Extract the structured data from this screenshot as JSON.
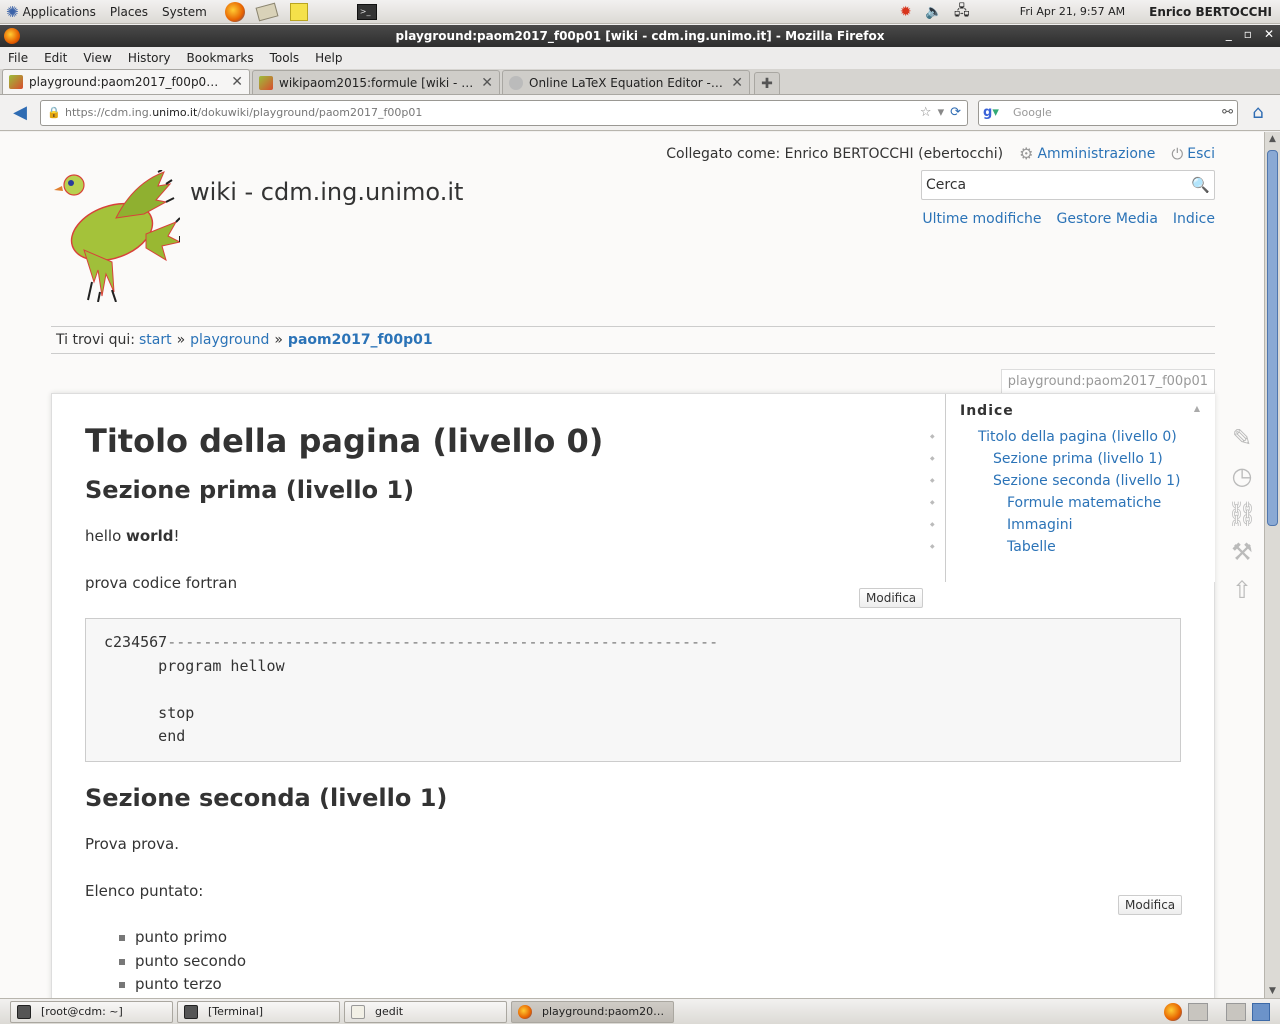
{
  "top_panel": {
    "menus": [
      "Applications",
      "Places",
      "System"
    ],
    "clock": "Fri Apr 21,  9:57 AM",
    "user": "Enrico BERTOCCHI"
  },
  "window": {
    "title": "playground:paom2017_f00p01 [wiki - cdm.ing.unimo.it] - Mozilla Firefox"
  },
  "menubar": [
    "File",
    "Edit",
    "View",
    "History",
    "Bookmarks",
    "Tools",
    "Help"
  ],
  "tabs": [
    {
      "label": "playground:paom2017_f00p01 [wik..."
    },
    {
      "label": "wikipaom2015:formule [wiki - cdm.i..."
    },
    {
      "label": "Online LaTeX Equation Editor - creat..."
    }
  ],
  "navbar": {
    "url_prefix": "https://cdm.ing.",
    "url_domain": "unimo.it",
    "url_suffix": "/dokuwiki/playground/paom2017_f00p01",
    "search_placeholder": "Google"
  },
  "wiki": {
    "user_label": "Collegato come: Enrico BERTOCCHI (ebertocchi)",
    "admin_link": "Amministrazione",
    "logout_link": "Esci",
    "site_title": "wiki - cdm.ing.unimo.it",
    "search_value": "Cerca",
    "quicklinks": [
      "Ultime modifiche",
      "Gestore Media",
      "Indice"
    ],
    "breadcrumb_label": "Ti trovi qui:",
    "breadcrumb": [
      "start",
      "playground",
      "paom2017_f00p01"
    ],
    "breadcrumb_sep": "»",
    "page_id": "playground:paom2017_f00p01",
    "edit_label": "Modifica"
  },
  "toc": {
    "title": "Indice",
    "items": [
      {
        "label": "Titolo della pagina (livello 0)",
        "level": 1
      },
      {
        "label": "Sezione prima (livello 1)",
        "level": 2
      },
      {
        "label": "Sezione seconda (livello 1)",
        "level": 2
      },
      {
        "label": "Formule matematiche",
        "level": 3
      },
      {
        "label": "Immagini",
        "level": 3
      },
      {
        "label": "Tabelle",
        "level": 3
      }
    ]
  },
  "content": {
    "h1": "Titolo della pagina (livello 0)",
    "h2_first": "Sezione prima (livello 1)",
    "hello_prefix": "hello ",
    "hello_bold": "world",
    "hello_suffix": "!",
    "code_intro": "prova codice fortran",
    "code_line1_prefix": "c234567",
    "code_line1_dashes": "-------------------------------------------------------------",
    "code_line2": "      program hellow",
    "code_line3": "",
    "code_line4": "      stop",
    "code_line5": "      end",
    "h2_second": "Sezione seconda (livello 1)",
    "p_prova": "Prova prova.",
    "p_elenco": "Elenco puntato:",
    "bullets": [
      "punto primo",
      "punto secondo",
      "punto terzo"
    ]
  },
  "taskbar": [
    {
      "label": "[root@cdm: ~]"
    },
    {
      "label": "[Terminal]"
    },
    {
      "label": "gedit"
    },
    {
      "label": "playground:paom201..."
    }
  ]
}
